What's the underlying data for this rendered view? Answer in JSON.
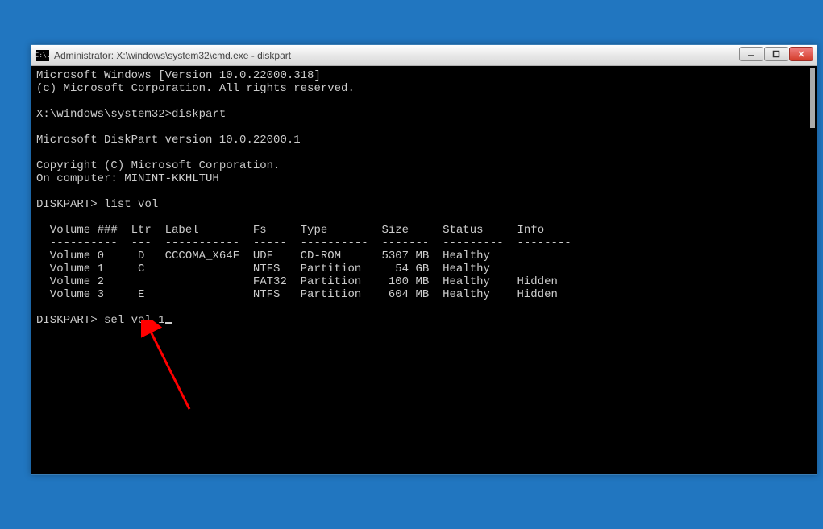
{
  "window": {
    "title": "Administrator: X:\\windows\\system32\\cmd.exe - diskpart",
    "icon_text": "C:\\."
  },
  "output": {
    "version_line": "Microsoft Windows [Version 10.0.22000.318]",
    "copyright_line": "(c) Microsoft Corporation. All rights reserved.",
    "prompt_path": "X:\\windows\\system32>",
    "first_command": "diskpart",
    "blank": "",
    "diskpart_version": "Microsoft DiskPart version 10.0.22000.1",
    "diskpart_copyright": "Copyright (C) Microsoft Corporation.",
    "computer_line": "On computer: MININT-KKHLTUH",
    "diskpart_prompt": "DISKPART>",
    "second_command": "list vol",
    "table_header": "  Volume ###  Ltr  Label        Fs     Type        Size     Status     Info",
    "table_divider": "  ----------  ---  -----------  -----  ----------  -------  ---------  --------",
    "rows": [
      "  Volume 0     D   CCCOMA_X64F  UDF    CD-ROM      5307 MB  Healthy",
      "  Volume 1     C                NTFS   Partition     54 GB  Healthy",
      "  Volume 2                      FAT32  Partition    100 MB  Healthy    Hidden",
      "  Volume 3     E                NTFS   Partition    604 MB  Healthy    Hidden"
    ],
    "current_command": "sel vol 1"
  }
}
